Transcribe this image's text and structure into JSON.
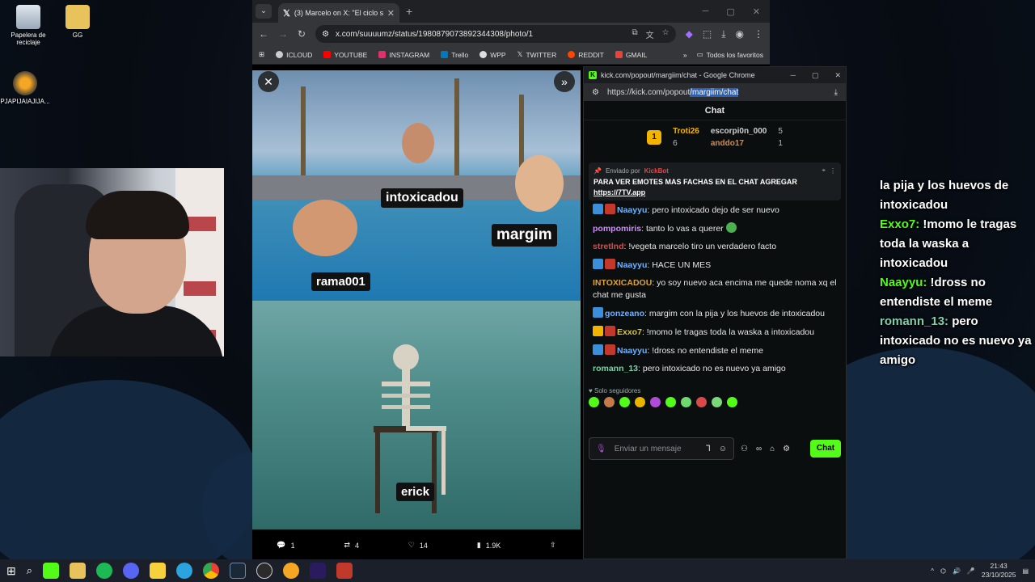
{
  "desktop": {
    "icons": [
      {
        "label": "Papelera de\nreciclaje",
        "icon": "recycle-bin-icon"
      },
      {
        "label": "GG",
        "icon": "folder-icon"
      },
      {
        "label": "PJAPIJAIAJIJA...",
        "icon": "fl-studio-icon"
      }
    ]
  },
  "browser": {
    "tab_title": "(3) Marcelo on X: \"El ciclo se rep",
    "url": "x.com/suuuumz/status/1980879073892344308/photo/1",
    "bookmarks": [
      "ICLOUD",
      "YOUTUBE",
      "INSTAGRAM",
      "Trello",
      "WPP",
      "TWITTER",
      "REDDIT",
      "GMAIL"
    ],
    "bookmarks_more": "»",
    "all_bookmarks": "Todos los favoritos"
  },
  "meme": {
    "labels": [
      "intoxicadou",
      "margim",
      "rama001",
      "erick"
    ]
  },
  "post_actions": {
    "replies": "1",
    "reposts": "4",
    "likes": "14",
    "views": "1.9K"
  },
  "kick": {
    "window_title": "kick.com/popout/margiim/chat - Google Chrome",
    "url_prefix": "https://kick.com/popout",
    "url_selected": "/margiim/chat",
    "chat_header": "Chat",
    "leaderboard": {
      "first_name": "Troti26",
      "first_count": "6",
      "first_rank": "1",
      "second_name": "escorpi0n_000",
      "second_count": "5",
      "third_name": "anddo17",
      "third_count": "1"
    },
    "pinned": {
      "sent_by": "Enviado por",
      "bot": "KickBot",
      "message": "PARA VER EMOTES MAS FACHAS EN EL CHAT AGREGAR",
      "link": "https://7TV.app"
    },
    "messages": [
      {
        "user": "Naayyu",
        "text": "pero intoxicado dejo de ser nuevo",
        "color": "#6fb3ff"
      },
      {
        "user": "pompomiris",
        "text": "tanto lo vas a querer",
        "color": "#d08cff"
      },
      {
        "user": "stretlnd",
        "text": "!vegeta marcelo tiro un verdadero facto",
        "color": "#e04848"
      },
      {
        "user": "Naayyu",
        "text": "HACE UN MES",
        "color": "#6fb3ff"
      },
      {
        "user": "INTOXICADOU",
        "text": "yo soy nuevo aca encima me quede noma xq el chat me gusta",
        "color": "#d9a441"
      },
      {
        "user": "gonzeano",
        "text": "margim con la pija y los huevos de intoxicadou",
        "color": "#6fb3ff"
      },
      {
        "user": "Exxo7",
        "text": "!momo le tragas toda la waska a intoxicadou",
        "color": "#d7c63a"
      },
      {
        "user": "Naayyu",
        "text": "!dross no entendiste el meme",
        "color": "#6fb3ff"
      },
      {
        "user": "romann_13",
        "text": "pero intoxicado no es nuevo ya amigo",
        "color": "#7fd0a8"
      }
    ],
    "followers_only": "Solo seguidores",
    "placeholder": "Enviar un mensaje",
    "send_label": "Chat",
    "accent": "#53fc18"
  },
  "overlay": {
    "lines": [
      {
        "user": "",
        "text": "la pija y los huevos de intoxicadou"
      },
      {
        "user": "Exxo7:",
        "text": "!momo le tragas toda la waska a intoxicadou"
      },
      {
        "user": "Naayyu:",
        "text": "!dross no entendiste el meme"
      },
      {
        "user": "romann_13:",
        "text": "pero intoxicado no es nuevo ya amigo"
      }
    ]
  },
  "taskbar": {
    "time": "21:43",
    "date": "23/10/2025"
  }
}
